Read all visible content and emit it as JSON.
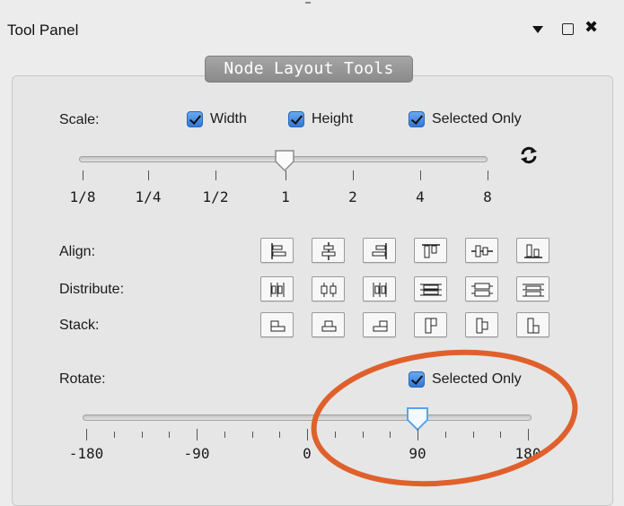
{
  "window": {
    "title": "Tool Panel",
    "menu_icon": "dropdown-arrow-icon",
    "float_icon": "square-icon",
    "close_icon": "close-icon"
  },
  "group": {
    "title": "Node Layout Tools"
  },
  "scale": {
    "label": "Scale:",
    "checkboxes": [
      {
        "label": "Width",
        "checked": true
      },
      {
        "label": "Height",
        "checked": true
      },
      {
        "label": "Selected Only",
        "checked": true
      }
    ],
    "tick_labels": [
      "1/8",
      "1/4",
      "1/2",
      "1",
      "2",
      "4",
      "8"
    ],
    "value": "1",
    "reset_icon": "refresh-icon"
  },
  "tools": {
    "align_label": "Align:",
    "distribute_label": "Distribute:",
    "stack_label": "Stack:"
  },
  "rotate": {
    "label": "Rotate:",
    "checkbox": {
      "label": "Selected Only",
      "checked": true
    },
    "tick_labels": [
      "-180",
      "-90",
      "0",
      "90",
      "180"
    ],
    "min": -180,
    "max": 180,
    "value": 90
  },
  "colors": {
    "accent": "#2f78d8",
    "annotation": "#e0602c",
    "group_title_bg": "#999999"
  }
}
